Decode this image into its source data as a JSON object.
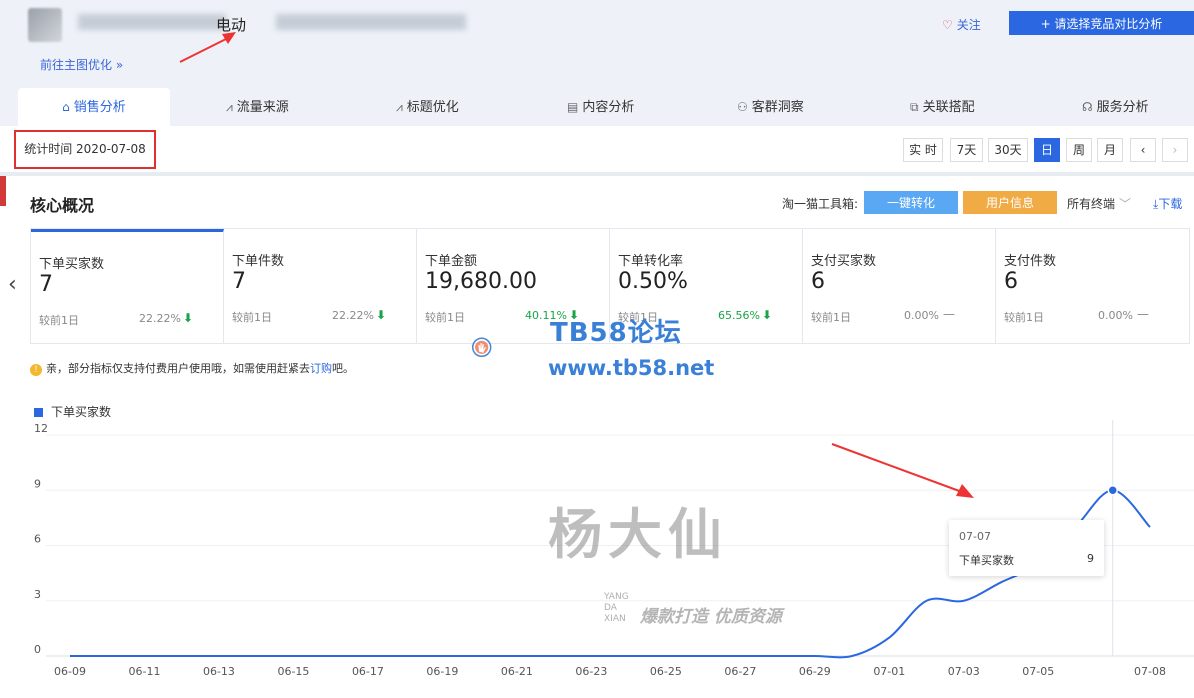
{
  "header": {
    "product_title": "电动",
    "follow_label": "关注",
    "compare_button": "+ 请选择竞品对比分析",
    "goto_link": "前往主图优化 »"
  },
  "tabs": [
    {
      "label": "销售分析",
      "icon": "shop-icon",
      "active": true
    },
    {
      "label": "流量来源",
      "icon": "trend-icon"
    },
    {
      "label": "标题优化",
      "icon": "trend-icon"
    },
    {
      "label": "内容分析",
      "icon": "document-icon"
    },
    {
      "label": "客群洞察",
      "icon": "users-icon"
    },
    {
      "label": "关联搭配",
      "icon": "link-icon"
    },
    {
      "label": "服务分析",
      "icon": "headset-icon"
    }
  ],
  "datebar": {
    "stat_time": "统计时间 2020-07-08",
    "buttons": [
      "实 时",
      "7天",
      "30天",
      "日",
      "周",
      "月",
      "‹",
      "›"
    ],
    "active": "日"
  },
  "core": {
    "title": "核心概况",
    "tools_label": "淘一猫工具箱:",
    "convert_button": "一键转化",
    "userinfo_button": "用户信息",
    "terminal_select": "所有终端",
    "download": "下载"
  },
  "metrics": [
    {
      "label": "下单买家数",
      "value": "7",
      "compare": "较前1日",
      "pct": "22.22%",
      "trend": "down",
      "selected": true
    },
    {
      "label": "下单件数",
      "value": "7",
      "compare": "较前1日",
      "pct": "22.22%",
      "trend": "down"
    },
    {
      "label": "下单金额",
      "value": "19,680.00",
      "compare": "较前1日",
      "pct": "40.11%",
      "trend": "down"
    },
    {
      "label": "下单转化率",
      "value": "0.50%",
      "compare": "较前1日",
      "pct": "65.56%",
      "trend": "down"
    },
    {
      "label": "支付买家数",
      "value": "6",
      "compare": "较前1日",
      "pct": "0.00%",
      "trend": "flat"
    },
    {
      "label": "支付件数",
      "value": "6",
      "compare": "较前1日",
      "pct": "0.00%",
      "trend": "flat"
    }
  ],
  "notice": {
    "text": "亲，部分指标仅支持付费用户使用哦，如需使用赶紧去",
    "link": "订购",
    "suffix": "吧。"
  },
  "watermarks": {
    "forum_title": "TB58论坛",
    "forum_url": "www.tb58.net",
    "brand_name": "杨大仙",
    "brand_pinyin": [
      "YANG",
      "DA",
      "XIAN"
    ],
    "slogan": "爆款打造 优质资源"
  },
  "tooltip": {
    "date": "07-07",
    "label": "下单买家数",
    "value": "9"
  },
  "colors": {
    "accent": "#2a67e0",
    "highlight_box": "#e02f2f",
    "convert_btn": "#5aa7f3",
    "userinfo_btn": "#f0ab45",
    "down_arrow": "#19a34a"
  },
  "chart_data": {
    "type": "line",
    "title": "",
    "series": [
      {
        "name": "下单买家数",
        "x": [
          "06-09",
          "06-10",
          "06-11",
          "06-12",
          "06-13",
          "06-14",
          "06-15",
          "06-16",
          "06-17",
          "06-18",
          "06-19",
          "06-20",
          "06-21",
          "06-22",
          "06-23",
          "06-24",
          "06-25",
          "06-26",
          "06-27",
          "06-28",
          "06-29",
          "06-30",
          "07-01",
          "07-02",
          "07-03",
          "07-04",
          "07-05",
          "07-06",
          "07-07",
          "07-08"
        ],
        "values": [
          0,
          0,
          0,
          0,
          0,
          0,
          0,
          0,
          0,
          0,
          0,
          0,
          0,
          0,
          0,
          0,
          0,
          0,
          0,
          0,
          0,
          0,
          1,
          3,
          3,
          4,
          5,
          7,
          9,
          7
        ]
      }
    ],
    "x_tick_labels": [
      "06-09",
      "06-11",
      "06-13",
      "06-15",
      "06-17",
      "06-19",
      "06-21",
      "06-23",
      "06-25",
      "06-27",
      "06-29",
      "07-01",
      "07-03",
      "07-05",
      "07-08"
    ],
    "y_ticks": [
      0,
      3,
      6,
      9,
      12
    ],
    "ylim": [
      0,
      12
    ],
    "grid": true,
    "legend": "top-left",
    "highlight_x": "07-07"
  }
}
